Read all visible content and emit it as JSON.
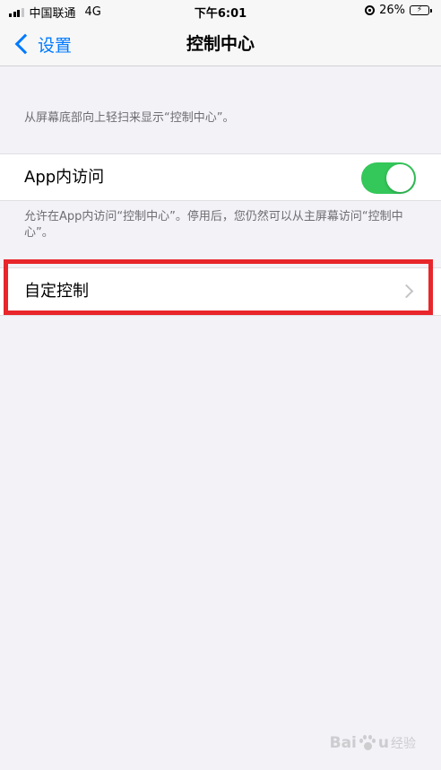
{
  "status_bar": {
    "carrier": "中国联通",
    "network": "4G",
    "time": "下午6:01",
    "battery": "26%",
    "battery_level": 0.26,
    "icons": [
      "signal-icon",
      "orientation-lock-icon",
      "battery-charging-icon"
    ]
  },
  "nav": {
    "back_label": "设置",
    "title": "控制中心",
    "back_icon": "chevron-left-icon"
  },
  "intro_text": "从屏幕底部向上轻扫来显示“控制中心”。",
  "access_within_apps": {
    "label": "App内访问",
    "enabled": true,
    "footnote": "允许在App内访问“控制中心”。停用后，您仍然可以从主屏幕访问“控制中心”。"
  },
  "customize_controls": {
    "label": "自定控制",
    "icon": "chevron-right-icon"
  },
  "colors": {
    "accent": "#007aff",
    "toggle_on": "#34c759",
    "highlight_box": "#e8262b",
    "background": "#f2f2f7"
  },
  "watermark": {
    "brand_left": "Bai",
    "brand_right": "u",
    "brand_cn": "经验",
    "icon": "paw-icon"
  }
}
